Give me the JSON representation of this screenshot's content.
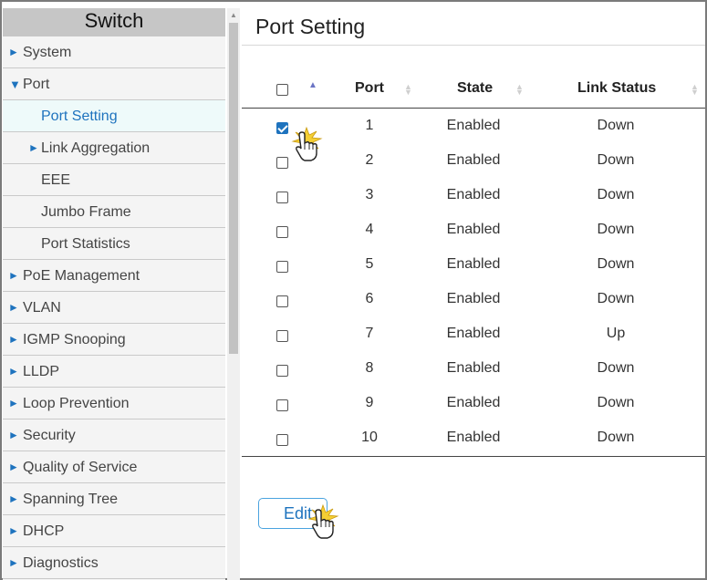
{
  "sidebar": {
    "title": "Switch",
    "items": [
      {
        "label": "System",
        "arrow": "►",
        "level": 0
      },
      {
        "label": "Port",
        "arrow": "▼",
        "level": 0
      },
      {
        "label": "Port Setting",
        "arrow": "",
        "level": 1,
        "active": true
      },
      {
        "label": "Link Aggregation",
        "arrow": "►",
        "level": 1
      },
      {
        "label": "EEE",
        "arrow": "",
        "level": 1
      },
      {
        "label": "Jumbo Frame",
        "arrow": "",
        "level": 1
      },
      {
        "label": "Port Statistics",
        "arrow": "",
        "level": 1
      },
      {
        "label": "PoE Management",
        "arrow": "►",
        "level": 0
      },
      {
        "label": "VLAN",
        "arrow": "►",
        "level": 0
      },
      {
        "label": "IGMP Snooping",
        "arrow": "►",
        "level": 0
      },
      {
        "label": "LLDP",
        "arrow": "►",
        "level": 0
      },
      {
        "label": "Loop Prevention",
        "arrow": "►",
        "level": 0
      },
      {
        "label": "Security",
        "arrow": "►",
        "level": 0
      },
      {
        "label": "Quality of Service",
        "arrow": "►",
        "level": 0
      },
      {
        "label": "Spanning Tree",
        "arrow": "►",
        "level": 0
      },
      {
        "label": "DHCP",
        "arrow": "►",
        "level": 0
      },
      {
        "label": "Diagnostics",
        "arrow": "►",
        "level": 0
      }
    ]
  },
  "main": {
    "title": "Port Setting",
    "table": {
      "headers": [
        "Port",
        "State",
        "Link Status"
      ],
      "rows": [
        {
          "port": "1",
          "state": "Enabled",
          "link": "Down",
          "checked": true
        },
        {
          "port": "2",
          "state": "Enabled",
          "link": "Down",
          "checked": false
        },
        {
          "port": "3",
          "state": "Enabled",
          "link": "Down",
          "checked": false
        },
        {
          "port": "4",
          "state": "Enabled",
          "link": "Down",
          "checked": false
        },
        {
          "port": "5",
          "state": "Enabled",
          "link": "Down",
          "checked": false
        },
        {
          "port": "6",
          "state": "Enabled",
          "link": "Down",
          "checked": false
        },
        {
          "port": "7",
          "state": "Enabled",
          "link": "Up",
          "checked": false
        },
        {
          "port": "8",
          "state": "Enabled",
          "link": "Down",
          "checked": false
        },
        {
          "port": "9",
          "state": "Enabled",
          "link": "Down",
          "checked": false
        },
        {
          "port": "10",
          "state": "Enabled",
          "link": "Down",
          "checked": false
        }
      ]
    },
    "edit_label": "Edit"
  },
  "icons": {
    "expand": "triangle-right-icon",
    "collapse": "triangle-down-icon",
    "sort": "sort-arrows-icon",
    "cursor": "hand-pointer-click-icon"
  },
  "colors": {
    "accent": "#1e73be",
    "sidebar_title_bg": "#c6c6c6",
    "active_item_bg": "#eefafa",
    "sort_active": "#6b74c4"
  }
}
